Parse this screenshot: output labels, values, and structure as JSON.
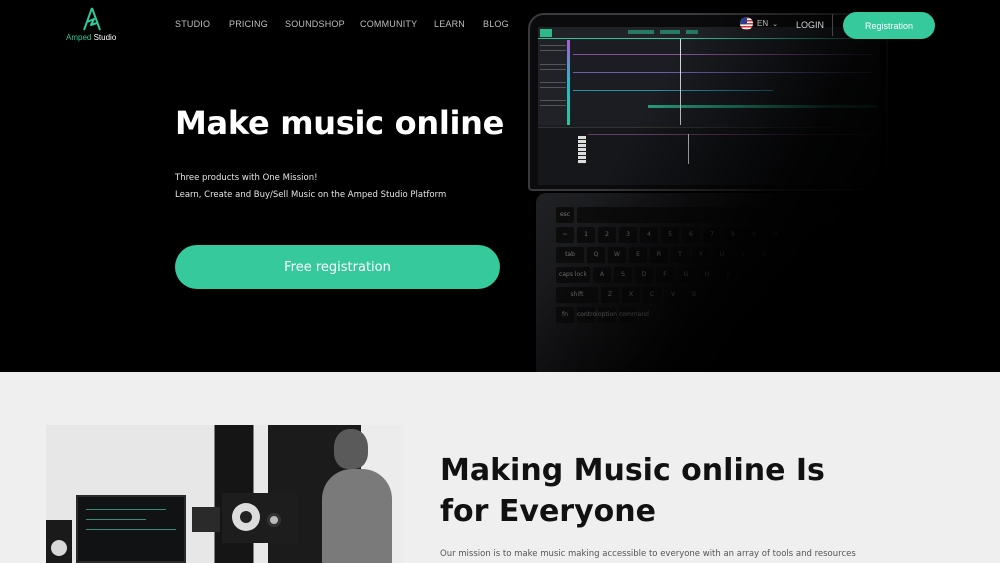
{
  "brand": {
    "name_part1": "Amped",
    "name_part2": " Studio",
    "accent_color": "#35c99b",
    "logo_icon": "amped-a-logo-icon"
  },
  "nav": {
    "items": [
      {
        "label": "STUDIO"
      },
      {
        "label": "PRICING"
      },
      {
        "label": "SOUNDSHOP"
      },
      {
        "label": "COMMUNITY"
      },
      {
        "label": "LEARN"
      },
      {
        "label": "BLOG"
      }
    ],
    "language": {
      "label": "EN",
      "flag_icon": "us-flag-icon",
      "chevron_icon": "chevron-down-icon"
    },
    "login_label": "LOGIN",
    "registration_label": "Registration"
  },
  "hero": {
    "title": "Make music online",
    "subtitle_line1": "Three products with One Mission!",
    "subtitle_line2": "Learn, Create and Buy/Sell Music on the Amped Studio Platform",
    "cta_label": "Free registration",
    "laptop_keys": {
      "row1": [
        "esc"
      ],
      "row2": [
        "~",
        "1",
        "2",
        "3",
        "4",
        "5",
        "6",
        "7",
        "8",
        "9",
        "0",
        "-"
      ],
      "row3": [
        "tab",
        "Q",
        "W",
        "E",
        "R",
        "T",
        "Y",
        "U",
        "I",
        "O"
      ],
      "row4": [
        "caps lock",
        "A",
        "S",
        "D",
        "F",
        "G",
        "H",
        "J"
      ],
      "row5": [
        "shift",
        "Z",
        "X",
        "C",
        "V",
        "B"
      ],
      "row6": [
        "fn",
        "control",
        "option",
        "command"
      ]
    }
  },
  "section": {
    "title": "Making Music online Is for Everyone",
    "text": "Our mission is to make music making accessible to everyone with an array of tools and resources"
  }
}
